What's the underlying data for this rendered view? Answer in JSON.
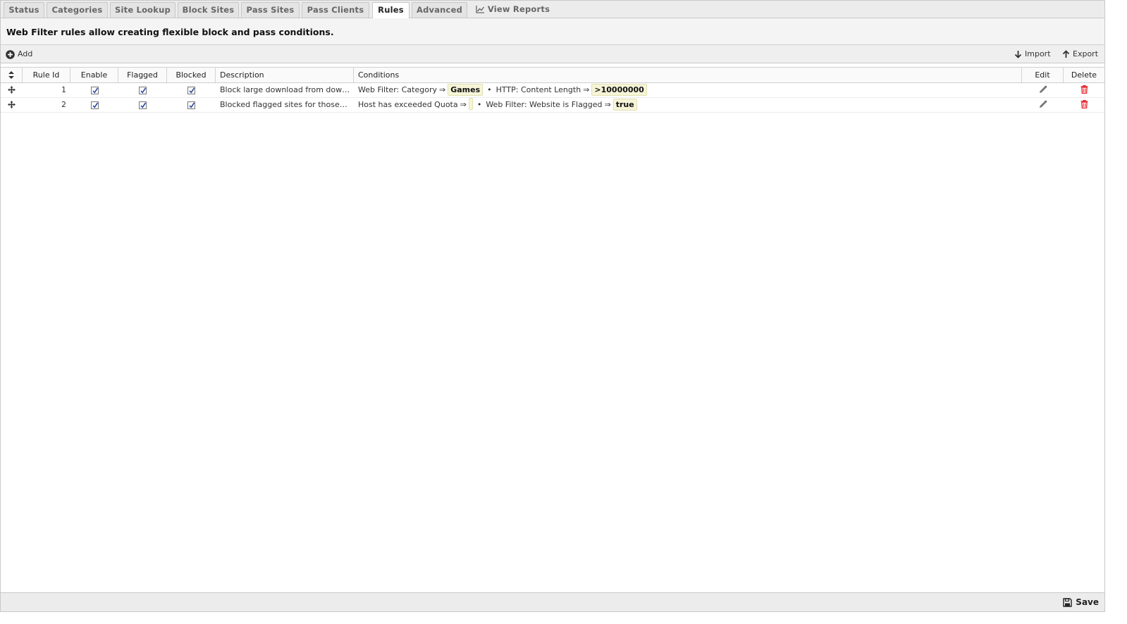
{
  "tabs": [
    {
      "label": "Status",
      "active": false
    },
    {
      "label": "Categories",
      "active": false
    },
    {
      "label": "Site Lookup",
      "active": false
    },
    {
      "label": "Block Sites",
      "active": false
    },
    {
      "label": "Pass Sites",
      "active": false
    },
    {
      "label": "Pass Clients",
      "active": false
    },
    {
      "label": "Rules",
      "active": true
    },
    {
      "label": "Advanced",
      "active": false
    },
    {
      "label": "View Reports",
      "active": false,
      "icon": "chart-line-icon"
    }
  ],
  "header": {
    "text": "Web Filter rules allow creating flexible block and pass conditions."
  },
  "toolbar": {
    "add_label": "Add",
    "import_label": "Import",
    "export_label": "Export"
  },
  "grid": {
    "columns": [
      "Rule Id",
      "Enable",
      "Flagged",
      "Blocked",
      "Description",
      "Conditions",
      "Edit",
      "Delete"
    ],
    "rows": [
      {
        "rule_id": "1",
        "enable": true,
        "flagged": true,
        "blocked": true,
        "description": "Block large download from dow…",
        "conditions": [
          {
            "name": "Web Filter: Category",
            "arrow": "⇒",
            "value": "Games"
          },
          {
            "name": "HTTP: Content Length",
            "arrow": "⇒",
            "value": ">10000000"
          }
        ]
      },
      {
        "rule_id": "2",
        "enable": true,
        "flagged": true,
        "blocked": true,
        "description": "Blocked flagged sites for those…",
        "conditions": [
          {
            "name": "Host has exceeded Quota",
            "arrow": "⇒",
            "value": ""
          },
          {
            "name": "Web Filter: Website is Flagged",
            "arrow": "⇒",
            "value": "true"
          }
        ]
      }
    ],
    "bullet": "•"
  },
  "footer": {
    "save_label": "Save"
  },
  "colors": {
    "delete_icon": "#e8202a",
    "value_chip_bg": "#f6f5d8"
  }
}
